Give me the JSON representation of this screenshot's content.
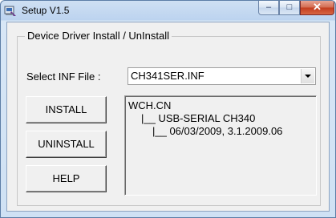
{
  "window": {
    "title": "Setup V1.5",
    "controls": {
      "minimize": "–",
      "maximize": "□",
      "close": "✕"
    }
  },
  "group": {
    "caption": "Device Driver Install / UnInstall"
  },
  "inf": {
    "label": "Select INF File :",
    "selected": "CH341SER.INF"
  },
  "buttons": {
    "install": "INSTALL",
    "uninstall": "UNINSTALL",
    "help": "HELP"
  },
  "info": {
    "lines": [
      "WCH.CN",
      "|__ USB-SERIAL CH340",
      "|__ 06/03/2009, 3.1.2009.06"
    ]
  }
}
